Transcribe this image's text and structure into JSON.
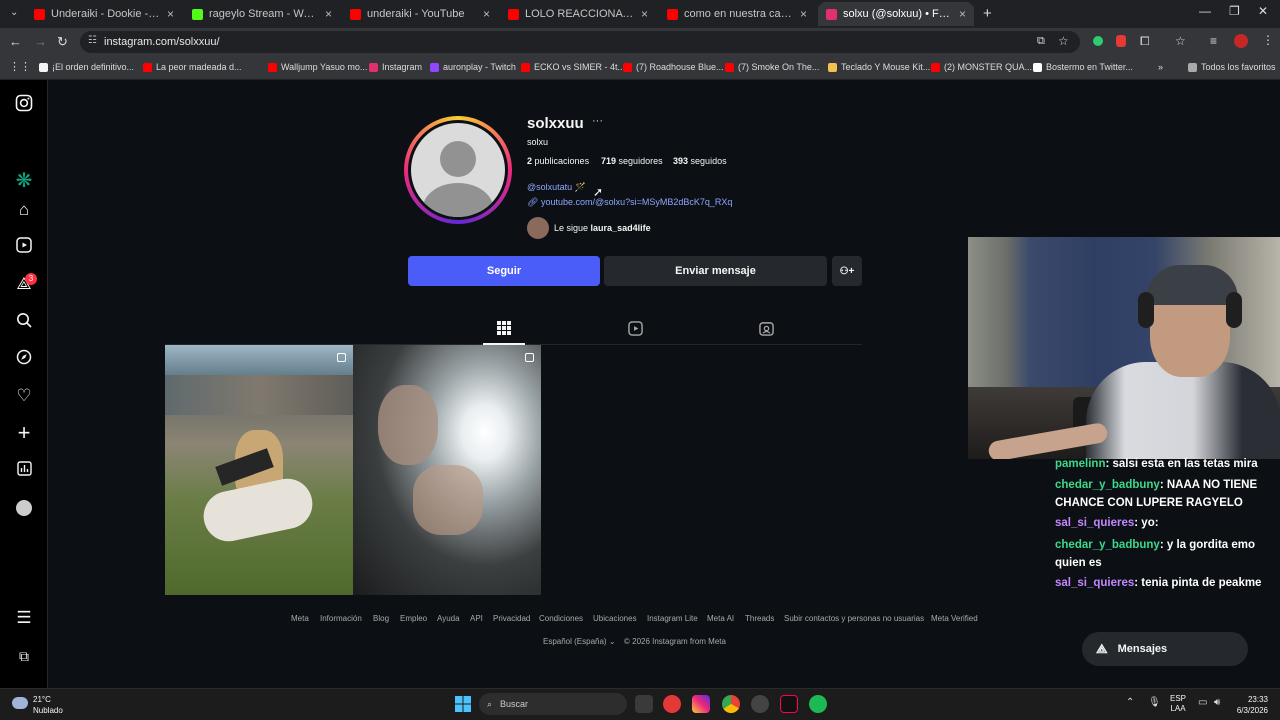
{
  "browser": {
    "tabs": [
      {
        "label": "Underaiki - Dookie - YouTube",
        "favicon_color": "#ff0000"
      },
      {
        "label": "rageylo Stream - Watch Live on",
        "favicon_color": "#53fc18"
      },
      {
        "label": "underaiki - YouTube",
        "favicon_color": "#ff0000"
      },
      {
        "label": "LOLO REACCIONA AL NUEVO E",
        "favicon_color": "#ff0000"
      },
      {
        "label": "como en nuestra casa - YouTub",
        "favicon_color": "#ff0000"
      },
      {
        "label": "solxu (@solxuu) • Fotos y víde",
        "favicon_color": "#e1306c",
        "active": true
      }
    ],
    "url": "instagram.com/solxxuu/",
    "bookmarks": [
      {
        "label": "¡El orden definitivo..."
      },
      {
        "label": "La peor madeada d..."
      },
      {
        "label": "Walljump Yasuo mo..."
      },
      {
        "label": "Instagram"
      },
      {
        "label": "auronplay - Twitch"
      },
      {
        "label": "ECKO vs SIMER - 4t..."
      },
      {
        "label": "(7) Roadhouse Blue..."
      },
      {
        "label": "(7) Smoke On The..."
      },
      {
        "label": "Teclado Y Mouse Kit..."
      },
      {
        "label": "(2) MONSTER QUA..."
      },
      {
        "label": "Bostermo en Twitter..."
      }
    ],
    "bookmarks_more": "»",
    "all_favorites": "Todos los favoritos"
  },
  "sidebar": {
    "notification_count": "3",
    "icons": [
      "instagram-icon",
      "chatgpt-icon",
      "home-icon",
      "reels-icon",
      "messages-icon",
      "search-icon",
      "explore-icon",
      "notifications-icon",
      "create-icon",
      "dashboard-icon",
      "profile-icon",
      "menu-icon",
      "meta-icon"
    ]
  },
  "profile": {
    "username": "solxxuu",
    "more": "···",
    "display_name": "solxu",
    "posts_count": "2",
    "posts_label": "publicaciones",
    "followers_count": "719",
    "followers_label": "seguidores",
    "following_count": "393",
    "following_label": "seguidos",
    "bio_handle": "@solxutatu",
    "bio_emoji": "🪄",
    "link": "youtube.com/@solxu?si=MSyMB2dBcK7q_RXq",
    "followed_by_prefix": "Le sigue",
    "followed_by_user": "laura_sad4life",
    "follow_button": "Seguir",
    "message_button": "Enviar mensaje",
    "add_user_icon": "add-user-icon"
  },
  "tabs_icons": [
    "grid-icon",
    "reels-icon",
    "tagged-icon"
  ],
  "footer": {
    "links": [
      "Meta",
      "Información",
      "Blog",
      "Empleo",
      "Ayuda",
      "API",
      "Privacidad",
      "Condiciones",
      "Ubicaciones",
      "Instagram Lite",
      "Meta AI",
      "Threads",
      "Subir contactos y personas no usuarias",
      "Meta Verified"
    ],
    "language": "Español (España)",
    "copyright": "© 2026 Instagram from Meta"
  },
  "messages_button": "Mensajes",
  "chat": [
    {
      "user": "pamelinn",
      "text": ": salsi esta en las tetas mira",
      "color": "#3cd98a"
    },
    {
      "user": "chedar_y_badbuny",
      "text": ": NAAA NO TIENE CHANCE CON LUPERE RAGYELO",
      "color": "#3cd98a"
    },
    {
      "user": "sal_si_quieres",
      "text": ": yo:",
      "color": "#c287ff"
    },
    {
      "user": "chedar_y_badbuny",
      "text": ": y la gordita emo quien es",
      "color": "#3cd98a"
    },
    {
      "user": "sal_si_quieres",
      "text": ": tenia pinta de peakme",
      "color": "#c287ff"
    }
  ],
  "taskbar": {
    "temperature": "21°C",
    "weather": "Nublado",
    "search_placeholder": "Buscar",
    "lang1": "ESP",
    "lang2": "LAA",
    "time": "23:33",
    "date": "6/3/2026"
  }
}
